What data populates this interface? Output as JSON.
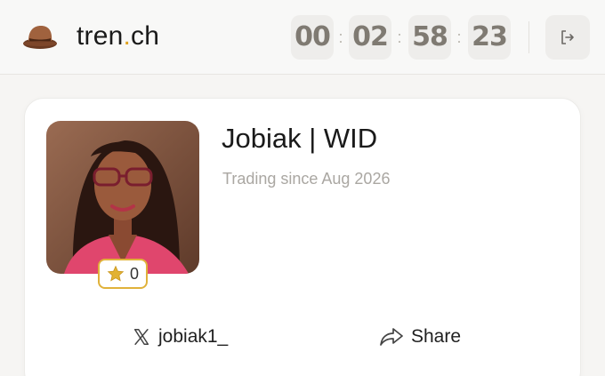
{
  "header": {
    "brand_prefix": "tren",
    "brand_dot": ".",
    "brand_suffix": "ch",
    "logo_icon": "hat-icon",
    "timer": {
      "d": "00",
      "h": "02",
      "m": "58",
      "s": "23",
      "separator": ":"
    },
    "logout_icon": "logout-icon"
  },
  "profile": {
    "name": "Jobiak | WID",
    "since": "Trading since Aug 2026",
    "star_count": "0",
    "star_icon": "star-icon",
    "x_handle": "jobiak1_",
    "share_label": "Share"
  },
  "colors": {
    "accent": "#e0a21e",
    "badge_border": "#e0b23a",
    "star_fill": "#e2b233",
    "timer_text": "#7f7a72"
  }
}
